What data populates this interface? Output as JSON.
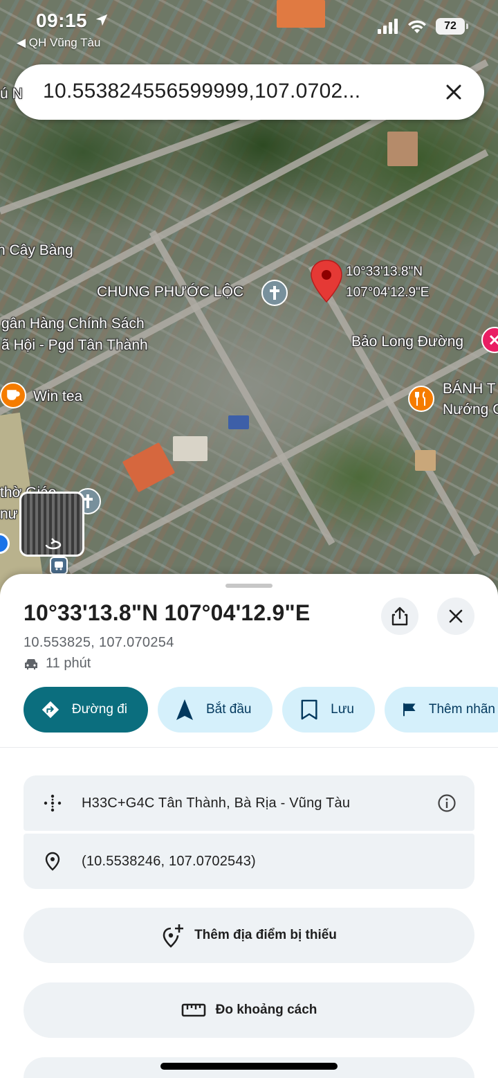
{
  "status_bar": {
    "time": "09:15",
    "back_app": "◀ QH Vũng Tàu",
    "battery": "72"
  },
  "search": {
    "query": "10.553824556599999,107.0702..."
  },
  "map": {
    "pin_label": [
      "10°33'13.8\"N",
      "107°04'12.9\"E"
    ],
    "labels": {
      "cay_bang": "n Cây Bàng",
      "church": "CHUNG PHƯỚC LỘC",
      "bank_line1": "gân Hàng Chính Sách",
      "bank_line2": "ã Hội - Pgd Tân Thành",
      "bao_long": "Bảo Long Đường",
      "win_tea": "Win tea",
      "banh_line1": "BÁNH T",
      "banh_line2": "Nướng C",
      "left_frag_1": "thờ Giáo",
      "left_frag_2": "nư",
      "top_frag": "ú N"
    },
    "icons": [
      "church-icon",
      "cafe-icon",
      "restaurant-icon",
      "store-icon",
      "bus-icon",
      "street-view-thumbnail"
    ]
  },
  "sheet": {
    "title": "10°33'13.8\"N 107°04'12.9\"E",
    "decimal_coords": "10.553825, 107.070254",
    "drive_time": "11 phút",
    "chips": [
      {
        "label": "Đường đi",
        "icon": "directions-icon"
      },
      {
        "label": "Bắt đầu",
        "icon": "navigation-arrow-icon"
      },
      {
        "label": "Lưu",
        "icon": "bookmark-icon"
      },
      {
        "label": "Thêm nhãn",
        "icon": "flag-icon"
      }
    ],
    "plus_code": "H33C+G4C Tân Thành, Bà Rịa - Vũng Tàu",
    "coordinates": "(10.5538246, 107.0702543)",
    "add_missing_place": "Thêm địa điểm bị thiếu",
    "measure_distance": "Đo khoảng cách"
  },
  "colors": {
    "primary_chip": "#0b6e7e",
    "secondary_chip": "#d5f0fb",
    "pin": "#e53935"
  }
}
